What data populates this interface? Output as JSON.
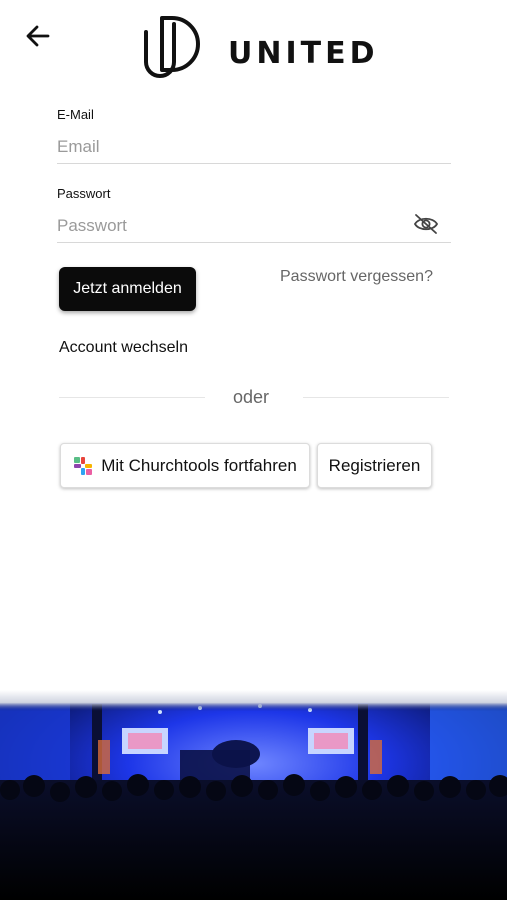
{
  "header": {
    "back_icon": "arrow-left-icon",
    "logo_text": "UNITED"
  },
  "login": {
    "email_label": "E-Mail",
    "email_placeholder": "Email",
    "email_value": "",
    "password_label": "Passwort",
    "password_placeholder": "Passwort",
    "password_value": "",
    "visibility_icon": "eye-off-icon",
    "submit_label": "Jetzt anmelden",
    "forgot_label": "Passwort vergessen?",
    "switch_account_label": "Account wechseln"
  },
  "divider": {
    "text": "oder"
  },
  "alternatives": {
    "churchtools_label": "Mit Churchtools fortfahren",
    "churchtools_icon": "churchtools-icon",
    "register_label": "Registrieren"
  },
  "colors": {
    "primary": "#0b0b0b",
    "muted_text": "#666666",
    "stage_blue": "#1f3cff"
  }
}
